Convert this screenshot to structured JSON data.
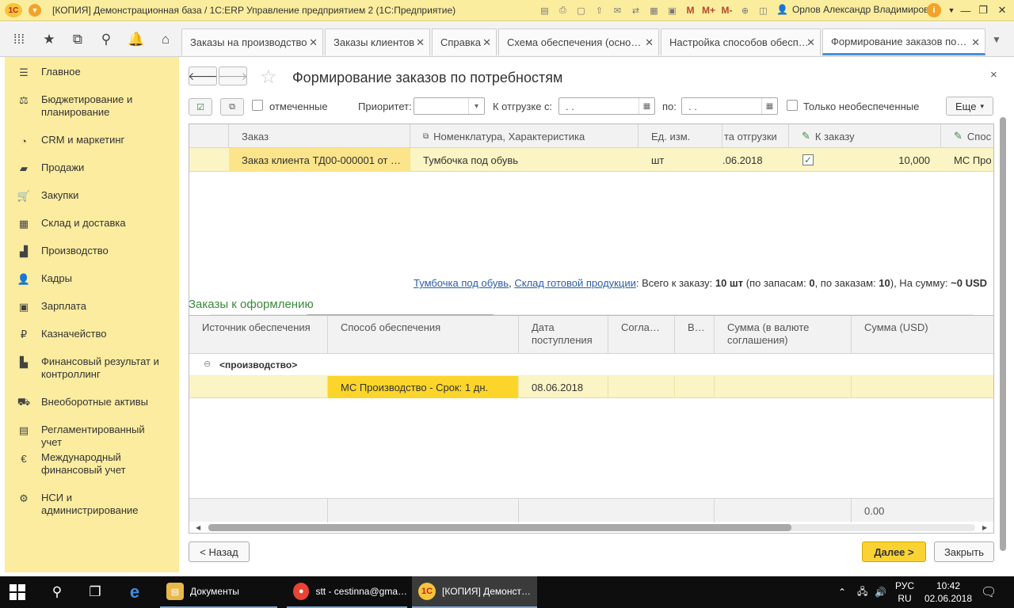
{
  "window": {
    "title": "[КОПИЯ] Демонстрационная база / 1С:ERP Управление предприятием 2  (1С:Предприятие)",
    "logo_text": "1С",
    "user": "Орлов Александр Владимирович",
    "toolbar_memory": [
      "M",
      "M+",
      "M-"
    ],
    "controls": {
      "minimize": "—",
      "restore": "❐",
      "close": "✕"
    }
  },
  "tabs": [
    {
      "label": "Заказы на производство",
      "close": "✕"
    },
    {
      "label": "Заказы клиентов",
      "close": "✕"
    },
    {
      "label": "Справка",
      "close": "✕"
    },
    {
      "label": "Схема обеспечения (осно…",
      "close": "✕"
    },
    {
      "label": "Настройка способов обесп…",
      "close": "✕"
    },
    {
      "label": "Формирование заказов по…",
      "close": "✕"
    }
  ],
  "sidebar": {
    "items": [
      {
        "label": "Главное",
        "icon": "menu-icon"
      },
      {
        "label": "Бюджетирование и планирование",
        "icon": "budget-icon"
      },
      {
        "label": "CRM и маркетинг",
        "icon": "crm-icon"
      },
      {
        "label": "Продажи",
        "icon": "sales-icon"
      },
      {
        "label": "Закупки",
        "icon": "cart-icon"
      },
      {
        "label": "Склад и доставка",
        "icon": "warehouse-icon"
      },
      {
        "label": "Производство",
        "icon": "factory-icon"
      },
      {
        "label": "Кадры",
        "icon": "person-icon"
      },
      {
        "label": "Зарплата",
        "icon": "wallet-icon"
      },
      {
        "label": "Казначейство",
        "icon": "ruble-icon"
      },
      {
        "label": "Финансовый результат и контроллинг",
        "icon": "chart-icon"
      },
      {
        "label": "Внеоборотные активы",
        "icon": "truck-icon"
      },
      {
        "label": "Регламентированный учет",
        "icon": "calculator-icon"
      },
      {
        "label": "Международный финансовый учет",
        "icon": "euro-icon"
      },
      {
        "label": "НСИ и администрирование",
        "icon": "gear-icon"
      }
    ]
  },
  "form": {
    "title": "Формирование заказов по потребностям",
    "close": "×",
    "filters": {
      "marked_label": "отмеченные",
      "priority_label": "Приоритет:",
      "priority_value": "",
      "ship_from_label": "К отгрузке с:",
      "ship_from_value": " .  .",
      "ship_to_label": "по:",
      "ship_to_value": " .  .",
      "only_unsecured_label": "Только необеспеченные",
      "more_label": "Еще"
    },
    "needs_grid": {
      "columns": [
        "Заказ",
        "Номенклатура, Характеристика",
        "Ед. изм.",
        "та отгрузки",
        "К заказу",
        "Спос"
      ],
      "rows": [
        {
          "order": "Заказ клиента ТД00-000001 от …",
          "item": "Тумбочка под обувь",
          "unit": "шт",
          "ship_date": ".06.2018",
          "checked": true,
          "quantity": "10,000",
          "method": "МС Про"
        }
      ]
    },
    "summary": {
      "link1": "Тумбочка под обувь",
      "comma": ",",
      "link2": "Склад готовой продукции",
      "text1": ": Всего к заказу: ",
      "total": "10 шт",
      "text2": " (по запасам: ",
      "by_stock": "0",
      "text3": ", по заказам: ",
      "by_orders": "10",
      "text4": "), На сумму: ",
      "amount": "~0 USD"
    },
    "section_title": "Заказы к оформлению",
    "orders_grid": {
      "columns": [
        "Источник обеспечения",
        "Способ обеспечения",
        "Дата поступления",
        "Согла…",
        "В…",
        "Сумма (в валюте соглашения)",
        "Сумма (USD)"
      ],
      "group_label": "<производство>",
      "group_toggle": "⊖",
      "rows": [
        {
          "source": "",
          "method": "МС Производство - Срок: 1 дн.",
          "date": "08.06.2018",
          "agreement": "",
          "currency": "",
          "sum_agreement": "",
          "sum_usd": ""
        }
      ],
      "footer_total": "0.00"
    },
    "buttons": {
      "back": "< Назад",
      "next": "Далее >",
      "close": "Закрыть"
    }
  },
  "taskbar": {
    "apps": [
      {
        "label": "Документы"
      },
      {
        "label": "stt - cestinna@gma…"
      },
      {
        "label": "[КОПИЯ] Демонст…"
      }
    ],
    "lang_top": "РУС",
    "lang_bottom": "RU",
    "time": "10:42",
    "date": "02.06.2018"
  },
  "colors": {
    "sidebar_bg": "#fbec9f",
    "title_bar_bg": "#fbed9e",
    "accent_blue": "#4a90d9",
    "primary_button": "#fad233",
    "section_green": "#3a8a3c",
    "link_blue": "#2a5fa8"
  }
}
